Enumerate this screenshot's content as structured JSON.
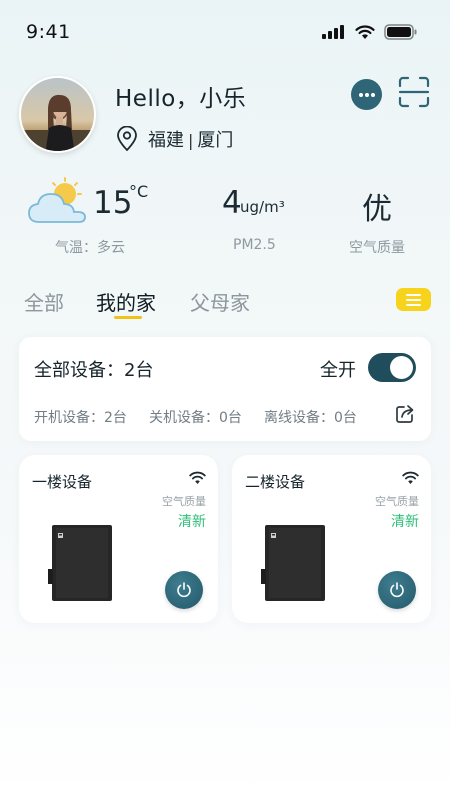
{
  "status_bar": {
    "time": "9:41"
  },
  "profile": {
    "greeting": "Hello，小乐",
    "province": "福建",
    "separator": "|",
    "city": "厦门"
  },
  "weather": {
    "temperature": "15",
    "temp_unit": "°C",
    "temp_label": "气温：多云",
    "pm_value": "4",
    "pm_unit": "ug/m³",
    "pm_label": "PM2.5",
    "air_quality": "优",
    "air_quality_label": "空气质量"
  },
  "tabs": [
    {
      "label": "全部",
      "active": false
    },
    {
      "label": "我的家",
      "active": true
    },
    {
      "label": "父母家",
      "active": false
    }
  ],
  "summary": {
    "title": "全部设备：2台",
    "all_on_label": "全开",
    "all_on": true,
    "stats": [
      "开机设备：2台",
      "关机设备：0台",
      "离线设备：0台"
    ]
  },
  "devices": [
    {
      "name": "一楼设备",
      "aq_label": "空气质量",
      "aq_value": "清新"
    },
    {
      "name": "二楼设备",
      "aq_label": "空气质量",
      "aq_value": "清新"
    }
  ],
  "colors": {
    "accent": "#2e6677",
    "tab_indicator": "#f2c21a",
    "good": "#2dbf78"
  }
}
